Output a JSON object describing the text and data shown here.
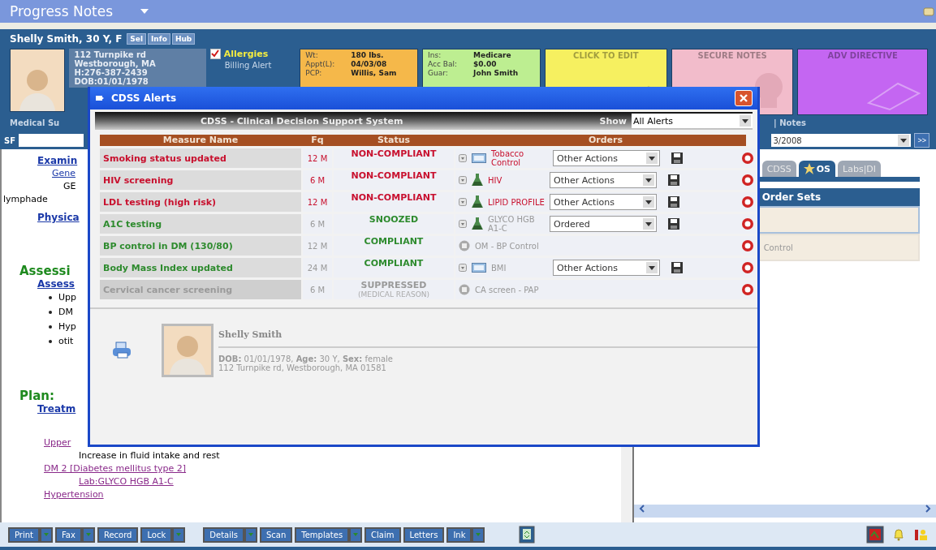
{
  "window": {
    "title": "Progress Notes"
  },
  "patient_header": {
    "name": "Shelly Smith, 30 Y, F",
    "buttons": [
      "Sel",
      "Info",
      "Hub"
    ],
    "address_lines": [
      "112 Turnpike rd",
      "Westborough, MA",
      "H:276-387-2439",
      "DOB:01/01/1978"
    ],
    "allergies": {
      "label": "Allergies",
      "checked": true
    },
    "billing_alert": "Billing Alert",
    "cards": [
      {
        "kind": "fields",
        "color": "#f5b84a",
        "rows": [
          {
            "label": "Wt:",
            "value": "180 lbs."
          },
          {
            "label": "Appt(L):",
            "value": "04/03/08"
          },
          {
            "label": "PCP:",
            "value": "Willis, Sam"
          }
        ]
      },
      {
        "kind": "fields",
        "color": "#bdee91",
        "rows": [
          {
            "label": "Ins:",
            "value": "Medicare"
          },
          {
            "label": "Acc Bal:",
            "value": "$0.00"
          },
          {
            "label": "Guar:",
            "value": "John Smith"
          }
        ]
      },
      {
        "kind": "edit",
        "color": "#f6f060",
        "title": "CLICK TO EDIT"
      },
      {
        "kind": "secure",
        "color": "#f2bccb",
        "title": "SECURE NOTES"
      },
      {
        "kind": "directive",
        "color": "#c466f2",
        "title": "ADV DIRECTIVE"
      }
    ],
    "section_tab": "Medical Su",
    "notes_link": "| Notes"
  },
  "search_row": {
    "label": "SF",
    "date": "3/2008",
    "go_button": ">>"
  },
  "notes": [
    {
      "kind": "section",
      "text": "Examin"
    },
    {
      "kind": "link",
      "text": "Gene"
    },
    {
      "kind": "text",
      "text": "GE"
    },
    {
      "kind": "plain",
      "text": "lymphade"
    },
    {
      "kind": "section",
      "text": "Physica"
    },
    {
      "kind": "heading",
      "text": "Assessi"
    },
    {
      "kind": "section",
      "text": "Assess"
    },
    {
      "kind": "bullet",
      "text": "Upp"
    },
    {
      "kind": "bullet",
      "text": "DM"
    },
    {
      "kind": "bullet",
      "text": "Hyp"
    },
    {
      "kind": "bullet",
      "text": "otit"
    },
    {
      "kind": "heading",
      "text": "Plan:"
    },
    {
      "kind": "section",
      "text": "Treatm"
    },
    {
      "kind": "problem",
      "text": "Upper",
      "children": [
        {
          "kind": "instruction",
          "text": "Increase in fluid intake and rest"
        }
      ]
    },
    {
      "kind": "problem",
      "text": "DM 2 [Diabetes mellitus type 2]",
      "children": [
        {
          "kind": "order",
          "text": "Lab:GLYCO HGB A1-C"
        }
      ]
    },
    {
      "kind": "problem",
      "text": "Hypertension"
    }
  ],
  "right_panel": {
    "tabs": [
      {
        "label": "CDSS",
        "selected": false,
        "starred": false
      },
      {
        "label": "OS",
        "selected": true,
        "starred": true
      },
      {
        "label": "Labs|DI",
        "selected": false,
        "starred": false
      }
    ],
    "order_sets": {
      "title": "Order Sets",
      "rows": [
        {
          "selected": true
        },
        {
          "label": "Control",
          "selected": false
        }
      ]
    }
  },
  "toolbar": {
    "groups": [
      [
        {
          "label": "Print",
          "dropdown": true
        },
        {
          "label": "Fax",
          "dropdown": true
        },
        {
          "label": "Record",
          "dropdown": false
        },
        {
          "label": "Lock",
          "dropdown": true
        }
      ],
      [
        {
          "label": "Details",
          "dropdown": true
        },
        {
          "label": "Scan",
          "dropdown": false
        },
        {
          "label": "Templates",
          "dropdown": true
        },
        {
          "label": "Claim",
          "dropdown": false
        },
        {
          "label": "Letters",
          "dropdown": false
        },
        {
          "label": "Ink",
          "dropdown": true
        }
      ]
    ]
  },
  "dialog": {
    "title": "CDSS Alerts",
    "heading": "CDSS - Clinical Decision Support System",
    "show_label": "Show",
    "show_value": "All Alerts",
    "columns": [
      "Measure Name",
      "Fq",
      "Status",
      "Orders"
    ],
    "rows": [
      {
        "kind": "non_compliant",
        "measure": "Smoking status updated",
        "frequency": "12 M",
        "status": "NON-COMPLIANT",
        "order": {
          "kind": "imaging_order",
          "name": "Tobacco Control",
          "action": "Other Actions"
        }
      },
      {
        "kind": "non_compliant",
        "measure": "HIV screening",
        "frequency": "6 M",
        "status": "NON-COMPLIANT",
        "order": {
          "kind": "lab_order",
          "name": "HIV",
          "action": "Other Actions"
        }
      },
      {
        "kind": "non_compliant",
        "measure": "LDL testing (high risk)",
        "frequency": "12 M",
        "status": "NON-COMPLIANT",
        "order": {
          "kind": "lab_order",
          "name": "LIPID PROFILE",
          "action": "Other Actions"
        }
      },
      {
        "kind": "snoozed",
        "measure": "A1C testing",
        "frequency": "6 M",
        "status": "SNOOZED",
        "order": {
          "kind": "lab_order",
          "name": "GLYCO HGB A1-C",
          "action": "Ordered"
        }
      },
      {
        "kind": "compliant",
        "measure": "BP control in DM (130/80)",
        "frequency": "12 M",
        "status": "COMPLIANT",
        "order": {
          "kind": "reference",
          "name": "OM - BP Control"
        }
      },
      {
        "kind": "compliant",
        "measure": "Body Mass Index updated",
        "frequency": "24 M",
        "status": "COMPLIANT",
        "order": {
          "kind": "imaging_order",
          "name": "BMI",
          "action": "Other Actions"
        }
      },
      {
        "kind": "suppressed",
        "measure": "Cervical cancer screening",
        "frequency": "6 M",
        "status": "SUPPRESSED",
        "status_note": "(MEDICAL REASON)",
        "order": {
          "kind": "reference",
          "name": "CA screen - PAP"
        }
      }
    ],
    "patient": {
      "name": "Shelly Smith",
      "details": "**DOB:** 01/01/1978,  **Age:** 30 Y,  **Sex:** female",
      "address": "112 Turnpike rd, Westborough, MA 01581"
    }
  }
}
